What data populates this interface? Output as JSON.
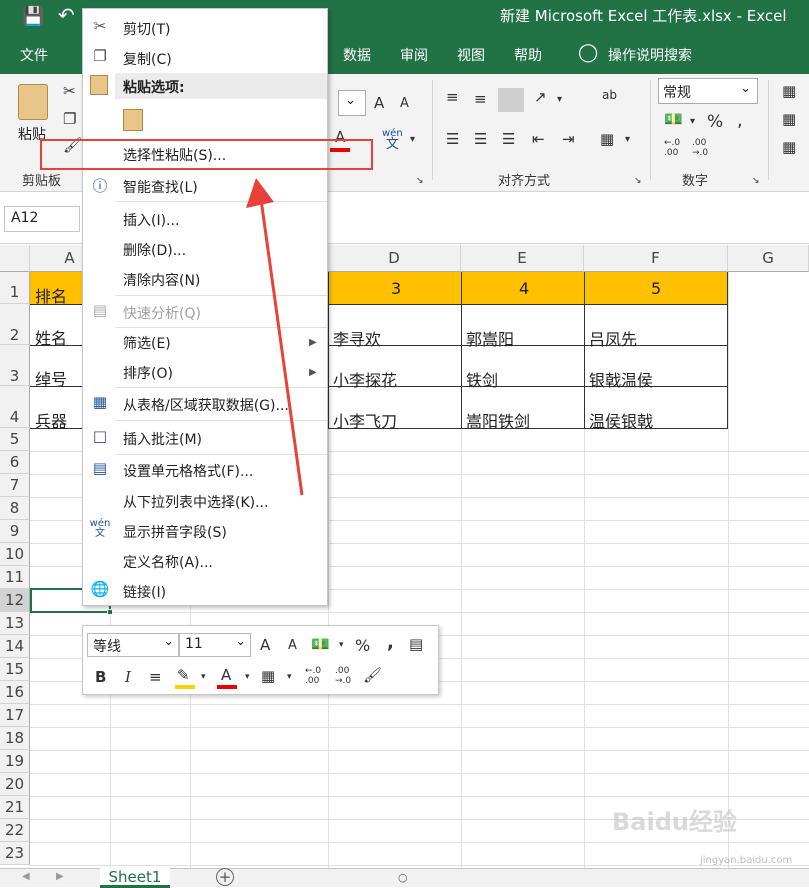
{
  "window": {
    "title": "新建 Microsoft Excel 工作表.xlsx  -  Excel"
  },
  "menubar": {
    "file": "文件",
    "data": "数据",
    "review": "审阅",
    "view": "视图",
    "help": "帮助",
    "tell_me": "操作说明搜索"
  },
  "ribbon": {
    "paste_label": "粘贴",
    "clipboard_group": "剪贴板",
    "alignment_group": "对齐方式",
    "number_group": "数字",
    "number_format": "常规",
    "wen_top": "wén",
    "wen_bottom": "文",
    "percent": "%",
    "dec_inc": "←.0\n.00",
    "dec_dec": ".00\n→.0",
    "ab": "ab",
    "font_a_up": "A",
    "font_a_down": "A",
    "font_color_a": "A"
  },
  "namebox": "A12",
  "columns": {
    "A": "A",
    "D": "D",
    "E": "E",
    "F": "F",
    "G": "G"
  },
  "rows": [
    "1",
    "2",
    "3",
    "4",
    "5",
    "6",
    "7",
    "8",
    "9",
    "10",
    "11",
    "12",
    "13",
    "14",
    "15",
    "16",
    "17",
    "18",
    "19",
    "20",
    "21",
    "22",
    "23"
  ],
  "cells": {
    "A1": "排名",
    "A2": "姓名",
    "A3": "绰号",
    "A4": "兵器",
    "D1": "3",
    "E1": "4",
    "F1": "5",
    "D2": "李寻欢",
    "E2": "郭嵩阳",
    "F2": "吕凤先",
    "D3": "小李探花",
    "E3": "铁剑",
    "F3": "银戟温侯",
    "D4": "小李飞刀",
    "E4": "嵩阳铁剑",
    "F4": "温侯银戟"
  },
  "context_menu": {
    "cut": "剪切(T)",
    "copy": "复制(C)",
    "paste_options": "粘贴选项:",
    "paste_special": "选择性粘贴(S)...",
    "smart_lookup": "智能查找(L)",
    "insert": "插入(I)...",
    "delete": "删除(D)...",
    "clear": "清除内容(N)",
    "quick_analysis": "快速分析(Q)",
    "filter": "筛选(E)",
    "sort": "排序(O)",
    "from_table": "从表格/区域获取数据(G)...",
    "insert_comment": "插入批注(M)",
    "format_cells": "设置单元格格式(F)...",
    "pick_list": "从下拉列表中选择(K)...",
    "phonetic": "显示拼音字段(S)",
    "define_name": "定义名称(A)...",
    "link": "链接(I)"
  },
  "mini_toolbar": {
    "font": "等线",
    "size": "11",
    "bold": "B",
    "italic": "I",
    "percent": "%",
    "comma": ","
  },
  "sheet": {
    "tab": "Sheet1",
    "add": "+"
  },
  "watermark": {
    "brand": "Baidu经验",
    "url": "jingyan.baidu.com"
  },
  "colors": {
    "excel_green": "#217346",
    "header_fill": "#ffc000",
    "annotation_red": "#e8413a",
    "selection_green": "#217346"
  }
}
